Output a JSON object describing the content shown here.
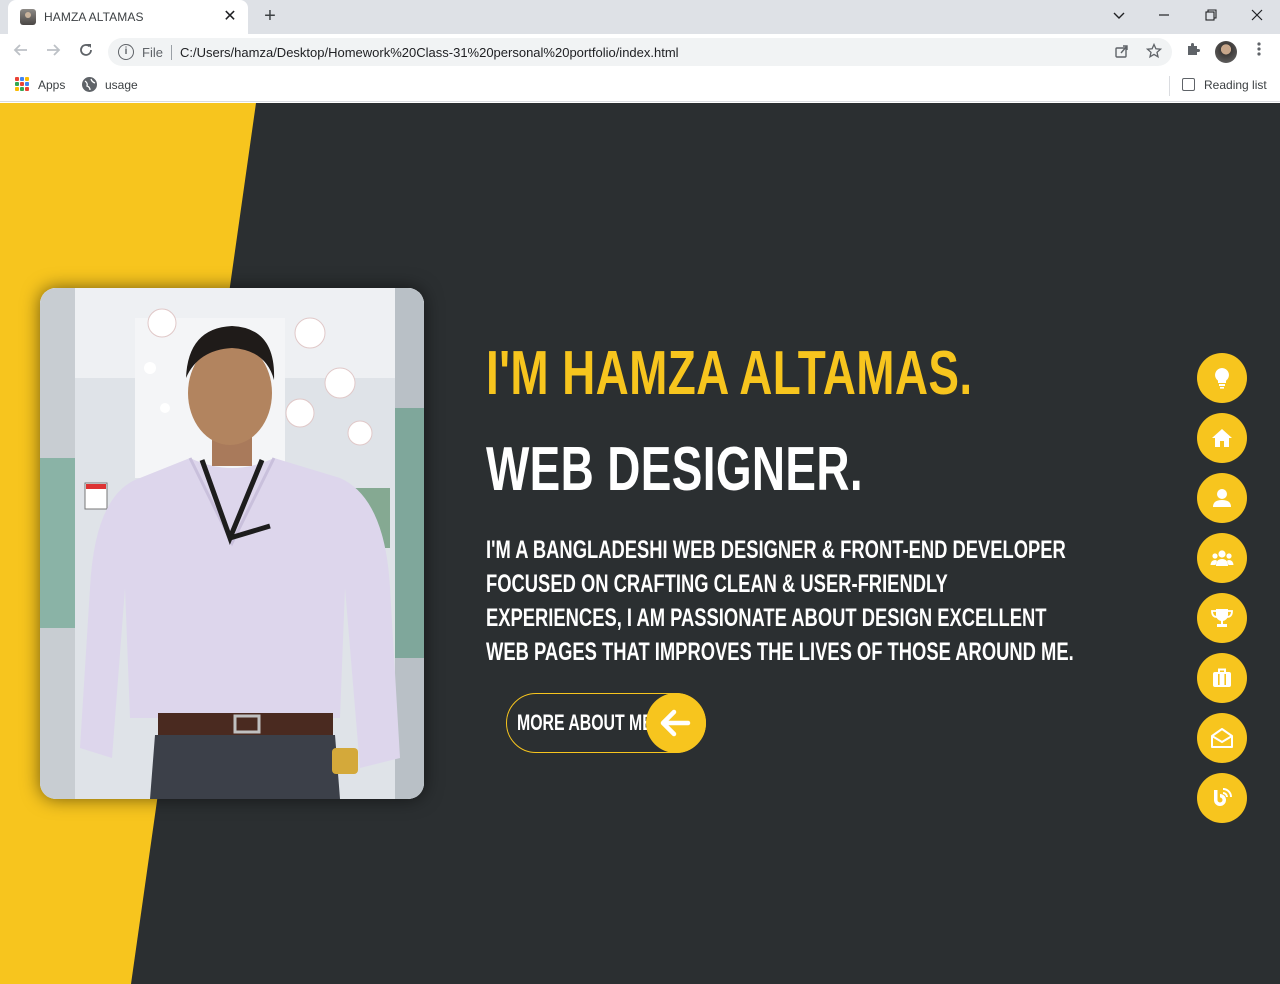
{
  "browser": {
    "tab_title": "HAMZA ALTAMAS",
    "tab_close": "✕",
    "new_tab": "+",
    "omnibox_scheme": "File",
    "url": "C:/Users/hamza/Desktop/Homework%20Class-31%20personal%20portfolio/index.html",
    "bookmarks": [
      {
        "label": "Apps",
        "icon": "apps-grid-icon"
      },
      {
        "label": "usage",
        "icon": "globe-icon"
      }
    ],
    "reading_list": "Reading list"
  },
  "hero": {
    "intro": "I'M HAMZA ALTAMAS.",
    "role": "WEB DESIGNER.",
    "bio": "I'M A BANGLADESHI WEB DESIGNER & FRONT-END DEVELOPER FOCUSED ON CRAFTING CLEAN & USER-FRIENDLY EXPERIENCES, I AM PASSIONATE ABOUT DESIGN EXCELLENT WEB PAGES THAT IMPROVES THE LIVES OF THOSE AROUND ME.",
    "cta_label": "MORE ABOUT ME",
    "cta_icon": "arrow-left-icon"
  },
  "side_nav": [
    {
      "icon": "lightbulb-icon"
    },
    {
      "icon": "home-icon"
    },
    {
      "icon": "user-icon"
    },
    {
      "icon": "users-icon"
    },
    {
      "icon": "trophy-icon"
    },
    {
      "icon": "briefcase-icon"
    },
    {
      "icon": "envelope-open-icon"
    },
    {
      "icon": "blog-icon"
    }
  ],
  "colors": {
    "accent": "#f7c51e",
    "background": "#2b2f31",
    "text": "#ffffff"
  }
}
